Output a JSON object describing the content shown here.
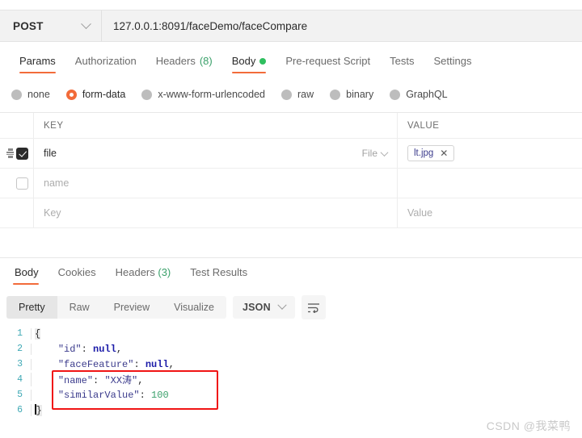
{
  "request": {
    "method": "POST",
    "url": "127.0.0.1:8091/faceDemo/faceCompare",
    "tabs": [
      {
        "label": "Params",
        "active": false,
        "count": "",
        "dot": false
      },
      {
        "label": "Authorization",
        "active": false,
        "count": "",
        "dot": false
      },
      {
        "label": "Headers",
        "active": false,
        "count": "(8)",
        "dot": false
      },
      {
        "label": "Body",
        "active": true,
        "count": "",
        "dot": true
      },
      {
        "label": "Pre-request Script",
        "active": false,
        "count": "",
        "dot": false
      },
      {
        "label": "Tests",
        "active": false,
        "count": "",
        "dot": false
      },
      {
        "label": "Settings",
        "active": false,
        "count": "",
        "dot": false
      }
    ],
    "body_types": [
      {
        "label": "none",
        "selected": false
      },
      {
        "label": "form-data",
        "selected": true
      },
      {
        "label": "x-www-form-urlencoded",
        "selected": false
      },
      {
        "label": "raw",
        "selected": false
      },
      {
        "label": "binary",
        "selected": false
      },
      {
        "label": "GraphQL",
        "selected": false
      }
    ],
    "table": {
      "headers": {
        "key": "KEY",
        "value": "VALUE"
      },
      "rows": [
        {
          "checked": true,
          "key": "file",
          "key_placeholder": "",
          "type_label": "File",
          "value_chip": "lt.jpg",
          "chip_close": "✕",
          "value_placeholder": ""
        },
        {
          "checked": false,
          "key": "",
          "key_placeholder": "name",
          "type_label": "",
          "value_chip": "",
          "chip_close": "",
          "value_placeholder": ""
        },
        {
          "checked": false,
          "key": "",
          "key_placeholder": "Key",
          "type_label": "",
          "value_chip": "",
          "chip_close": "",
          "value_placeholder": "Value"
        }
      ]
    }
  },
  "response": {
    "tabs": [
      {
        "label": "Body",
        "active": true,
        "count": ""
      },
      {
        "label": "Cookies",
        "active": false,
        "count": ""
      },
      {
        "label": "Headers",
        "active": false,
        "count": "(3)"
      },
      {
        "label": "Test Results",
        "active": false,
        "count": ""
      }
    ],
    "view_modes": [
      {
        "label": "Pretty",
        "active": true
      },
      {
        "label": "Raw",
        "active": false
      },
      {
        "label": "Preview",
        "active": false
      },
      {
        "label": "Visualize",
        "active": false
      }
    ],
    "format": "JSON",
    "code_lines": [
      {
        "n": "1",
        "segments": [
          {
            "t": "{",
            "c": "t-brace"
          }
        ]
      },
      {
        "n": "2",
        "segments": [
          {
            "t": "    ",
            "c": ""
          },
          {
            "t": "\"id\"",
            "c": "t-key"
          },
          {
            "t": ": ",
            "c": ""
          },
          {
            "t": "null",
            "c": "t-null"
          },
          {
            "t": ",",
            "c": ""
          }
        ]
      },
      {
        "n": "3",
        "segments": [
          {
            "t": "    ",
            "c": ""
          },
          {
            "t": "\"faceFeature\"",
            "c": "t-key"
          },
          {
            "t": ": ",
            "c": ""
          },
          {
            "t": "null",
            "c": "t-null"
          },
          {
            "t": ",",
            "c": ""
          }
        ]
      },
      {
        "n": "4",
        "segments": [
          {
            "t": "    ",
            "c": ""
          },
          {
            "t": "\"name\"",
            "c": "t-key"
          },
          {
            "t": ": ",
            "c": ""
          },
          {
            "t": "\"XX涛\"",
            "c": "t-str"
          },
          {
            "t": ",",
            "c": ""
          }
        ]
      },
      {
        "n": "5",
        "segments": [
          {
            "t": "    ",
            "c": ""
          },
          {
            "t": "\"similarValue\"",
            "c": "t-key"
          },
          {
            "t": ": ",
            "c": ""
          },
          {
            "t": "100",
            "c": "t-num"
          }
        ]
      },
      {
        "n": "6",
        "segments": [
          {
            "t": "}",
            "c": "t-brace"
          }
        ]
      }
    ],
    "highlight_note": "red annotation box around name and similarValue lines"
  },
  "watermark": "CSDN @我菜鸭",
  "colors": {
    "accent": "#f26b3a",
    "green": "#2fbf5f",
    "count_green": "#3aa06a",
    "highlight_red": "#f01414",
    "line_number": "#3fa9b5"
  }
}
